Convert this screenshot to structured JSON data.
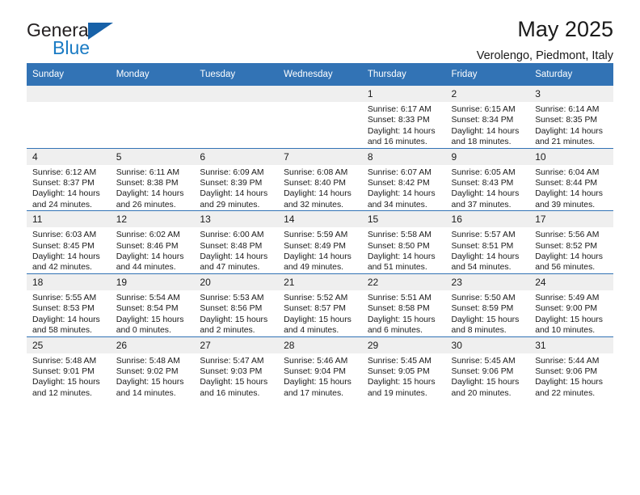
{
  "brand": {
    "name_top": "General",
    "name_bottom": "Blue",
    "triangle_color": "#1761a8",
    "blue_color": "#1a7bc4"
  },
  "header": {
    "title": "May 2025",
    "subtitle": "Verolengo, Piedmont, Italy"
  },
  "theme": {
    "header_blue": "#3273b5",
    "daynum_gray": "#efefef",
    "text": "#1a1a1a"
  },
  "calendar": {
    "weekday_headers": [
      "Sunday",
      "Monday",
      "Tuesday",
      "Wednesday",
      "Thursday",
      "Friday",
      "Saturday"
    ],
    "weeks": [
      [
        {
          "day": "",
          "empty": true,
          "lines": []
        },
        {
          "day": "",
          "empty": true,
          "lines": []
        },
        {
          "day": "",
          "empty": true,
          "lines": []
        },
        {
          "day": "",
          "empty": true,
          "lines": []
        },
        {
          "day": "1",
          "empty": false,
          "lines": [
            "Sunrise: 6:17 AM",
            "Sunset: 8:33 PM",
            "Daylight: 14 hours",
            "and 16 minutes."
          ]
        },
        {
          "day": "2",
          "empty": false,
          "lines": [
            "Sunrise: 6:15 AM",
            "Sunset: 8:34 PM",
            "Daylight: 14 hours",
            "and 18 minutes."
          ]
        },
        {
          "day": "3",
          "empty": false,
          "lines": [
            "Sunrise: 6:14 AM",
            "Sunset: 8:35 PM",
            "Daylight: 14 hours",
            "and 21 minutes."
          ]
        }
      ],
      [
        {
          "day": "4",
          "empty": false,
          "lines": [
            "Sunrise: 6:12 AM",
            "Sunset: 8:37 PM",
            "Daylight: 14 hours",
            "and 24 minutes."
          ]
        },
        {
          "day": "5",
          "empty": false,
          "lines": [
            "Sunrise: 6:11 AM",
            "Sunset: 8:38 PM",
            "Daylight: 14 hours",
            "and 26 minutes."
          ]
        },
        {
          "day": "6",
          "empty": false,
          "lines": [
            "Sunrise: 6:09 AM",
            "Sunset: 8:39 PM",
            "Daylight: 14 hours",
            "and 29 minutes."
          ]
        },
        {
          "day": "7",
          "empty": false,
          "lines": [
            "Sunrise: 6:08 AM",
            "Sunset: 8:40 PM",
            "Daylight: 14 hours",
            "and 32 minutes."
          ]
        },
        {
          "day": "8",
          "empty": false,
          "lines": [
            "Sunrise: 6:07 AM",
            "Sunset: 8:42 PM",
            "Daylight: 14 hours",
            "and 34 minutes."
          ]
        },
        {
          "day": "9",
          "empty": false,
          "lines": [
            "Sunrise: 6:05 AM",
            "Sunset: 8:43 PM",
            "Daylight: 14 hours",
            "and 37 minutes."
          ]
        },
        {
          "day": "10",
          "empty": false,
          "lines": [
            "Sunrise: 6:04 AM",
            "Sunset: 8:44 PM",
            "Daylight: 14 hours",
            "and 39 minutes."
          ]
        }
      ],
      [
        {
          "day": "11",
          "empty": false,
          "lines": [
            "Sunrise: 6:03 AM",
            "Sunset: 8:45 PM",
            "Daylight: 14 hours",
            "and 42 minutes."
          ]
        },
        {
          "day": "12",
          "empty": false,
          "lines": [
            "Sunrise: 6:02 AM",
            "Sunset: 8:46 PM",
            "Daylight: 14 hours",
            "and 44 minutes."
          ]
        },
        {
          "day": "13",
          "empty": false,
          "lines": [
            "Sunrise: 6:00 AM",
            "Sunset: 8:48 PM",
            "Daylight: 14 hours",
            "and 47 minutes."
          ]
        },
        {
          "day": "14",
          "empty": false,
          "lines": [
            "Sunrise: 5:59 AM",
            "Sunset: 8:49 PM",
            "Daylight: 14 hours",
            "and 49 minutes."
          ]
        },
        {
          "day": "15",
          "empty": false,
          "lines": [
            "Sunrise: 5:58 AM",
            "Sunset: 8:50 PM",
            "Daylight: 14 hours",
            "and 51 minutes."
          ]
        },
        {
          "day": "16",
          "empty": false,
          "lines": [
            "Sunrise: 5:57 AM",
            "Sunset: 8:51 PM",
            "Daylight: 14 hours",
            "and 54 minutes."
          ]
        },
        {
          "day": "17",
          "empty": false,
          "lines": [
            "Sunrise: 5:56 AM",
            "Sunset: 8:52 PM",
            "Daylight: 14 hours",
            "and 56 minutes."
          ]
        }
      ],
      [
        {
          "day": "18",
          "empty": false,
          "lines": [
            "Sunrise: 5:55 AM",
            "Sunset: 8:53 PM",
            "Daylight: 14 hours",
            "and 58 minutes."
          ]
        },
        {
          "day": "19",
          "empty": false,
          "lines": [
            "Sunrise: 5:54 AM",
            "Sunset: 8:54 PM",
            "Daylight: 15 hours",
            "and 0 minutes."
          ]
        },
        {
          "day": "20",
          "empty": false,
          "lines": [
            "Sunrise: 5:53 AM",
            "Sunset: 8:56 PM",
            "Daylight: 15 hours",
            "and 2 minutes."
          ]
        },
        {
          "day": "21",
          "empty": false,
          "lines": [
            "Sunrise: 5:52 AM",
            "Sunset: 8:57 PM",
            "Daylight: 15 hours",
            "and 4 minutes."
          ]
        },
        {
          "day": "22",
          "empty": false,
          "lines": [
            "Sunrise: 5:51 AM",
            "Sunset: 8:58 PM",
            "Daylight: 15 hours",
            "and 6 minutes."
          ]
        },
        {
          "day": "23",
          "empty": false,
          "lines": [
            "Sunrise: 5:50 AM",
            "Sunset: 8:59 PM",
            "Daylight: 15 hours",
            "and 8 minutes."
          ]
        },
        {
          "day": "24",
          "empty": false,
          "lines": [
            "Sunrise: 5:49 AM",
            "Sunset: 9:00 PM",
            "Daylight: 15 hours",
            "and 10 minutes."
          ]
        }
      ],
      [
        {
          "day": "25",
          "empty": false,
          "lines": [
            "Sunrise: 5:48 AM",
            "Sunset: 9:01 PM",
            "Daylight: 15 hours",
            "and 12 minutes."
          ]
        },
        {
          "day": "26",
          "empty": false,
          "lines": [
            "Sunrise: 5:48 AM",
            "Sunset: 9:02 PM",
            "Daylight: 15 hours",
            "and 14 minutes."
          ]
        },
        {
          "day": "27",
          "empty": false,
          "lines": [
            "Sunrise: 5:47 AM",
            "Sunset: 9:03 PM",
            "Daylight: 15 hours",
            "and 16 minutes."
          ]
        },
        {
          "day": "28",
          "empty": false,
          "lines": [
            "Sunrise: 5:46 AM",
            "Sunset: 9:04 PM",
            "Daylight: 15 hours",
            "and 17 minutes."
          ]
        },
        {
          "day": "29",
          "empty": false,
          "lines": [
            "Sunrise: 5:45 AM",
            "Sunset: 9:05 PM",
            "Daylight: 15 hours",
            "and 19 minutes."
          ]
        },
        {
          "day": "30",
          "empty": false,
          "lines": [
            "Sunrise: 5:45 AM",
            "Sunset: 9:06 PM",
            "Daylight: 15 hours",
            "and 20 minutes."
          ]
        },
        {
          "day": "31",
          "empty": false,
          "lines": [
            "Sunrise: 5:44 AM",
            "Sunset: 9:06 PM",
            "Daylight: 15 hours",
            "and 22 minutes."
          ]
        }
      ]
    ]
  }
}
